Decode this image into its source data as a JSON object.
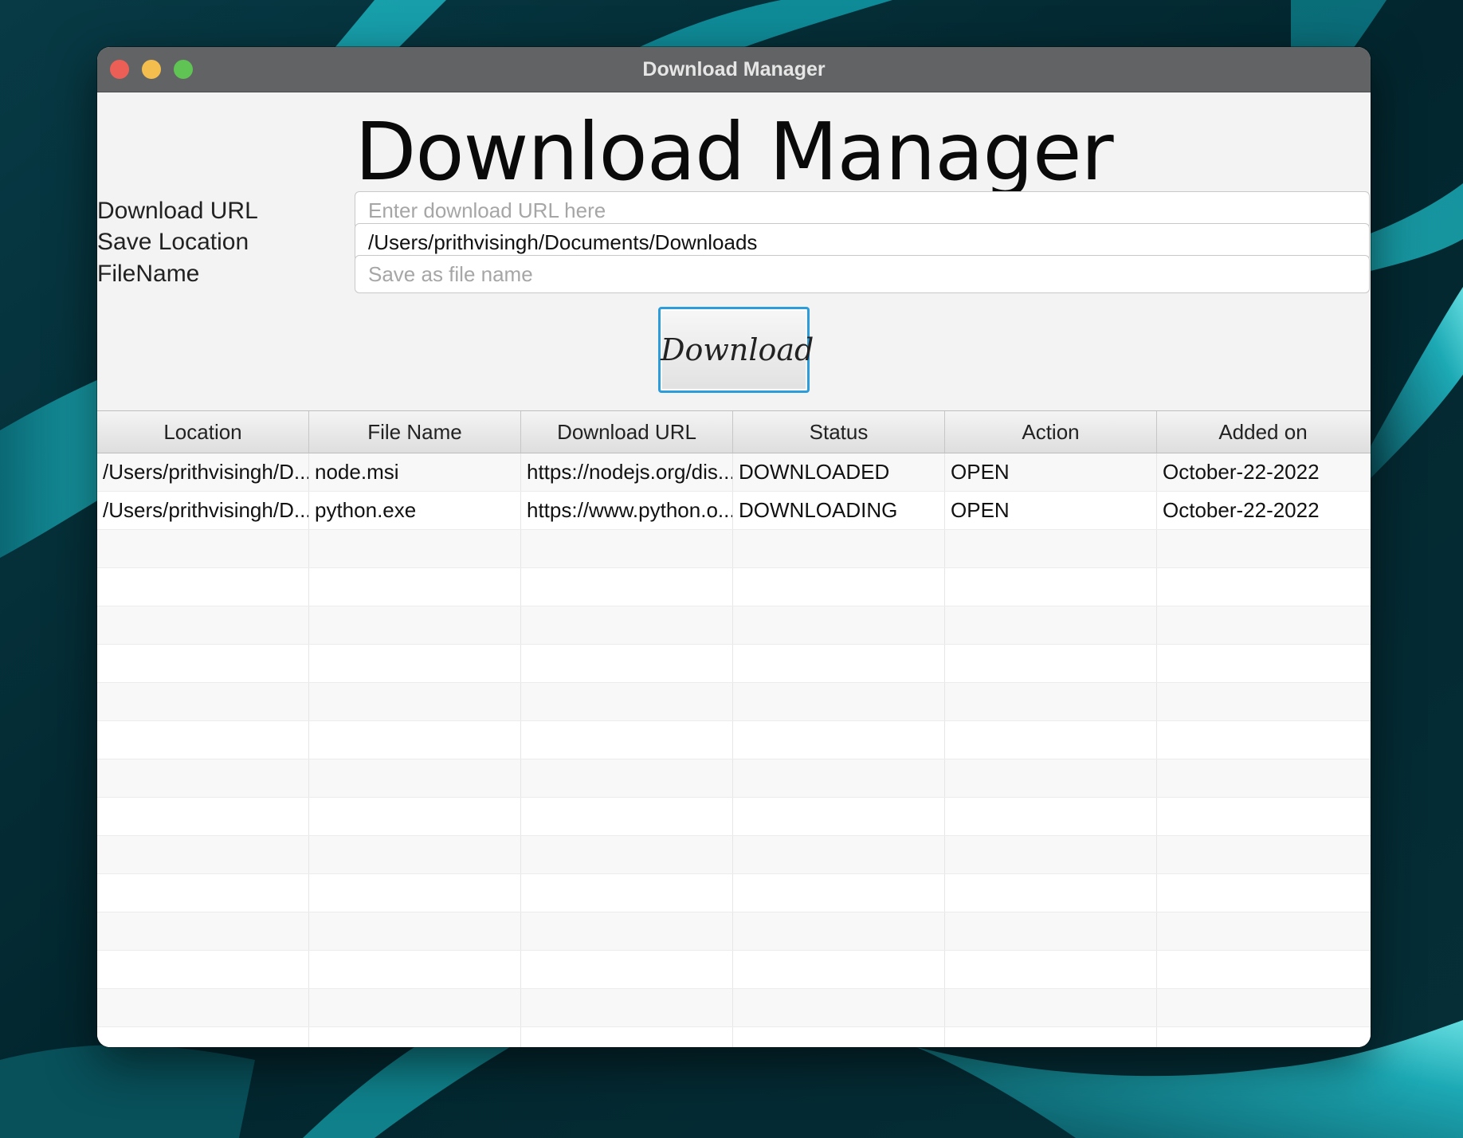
{
  "window": {
    "title": "Download Manager"
  },
  "heading": "Download Manager",
  "form": {
    "url_label": "Download URL",
    "url_placeholder": "Enter download URL here",
    "url_value": "",
    "location_label": "Save Location",
    "location_value": "/Users/prithvisingh/Documents/Downloads",
    "filename_label": "FileName",
    "filename_placeholder": "Save as file name",
    "filename_value": ""
  },
  "download_button_label": "Download",
  "table": {
    "columns": [
      "Location",
      "File Name",
      "Download URL",
      "Status",
      "Action",
      "Added on"
    ],
    "rows": [
      [
        "/Users/prithvisingh/D...",
        "node.msi",
        "https://nodejs.org/dis...",
        "DOWNLOADED",
        "OPEN",
        "October-22-2022"
      ],
      [
        "/Users/prithvisingh/D...",
        "python.exe",
        "https://www.python.o...",
        "DOWNLOADING",
        "OPEN",
        "October-22-2022"
      ]
    ]
  },
  "colors": {
    "desktop": "#042a33",
    "desktop_accent": "#2ad9e0",
    "titlebar": "#626364",
    "window_bg": "#f3f3f3",
    "button_focus": "#2d9cdb",
    "close": "#ec5f57",
    "minimize": "#f4be4f",
    "zoom": "#5fc454"
  }
}
